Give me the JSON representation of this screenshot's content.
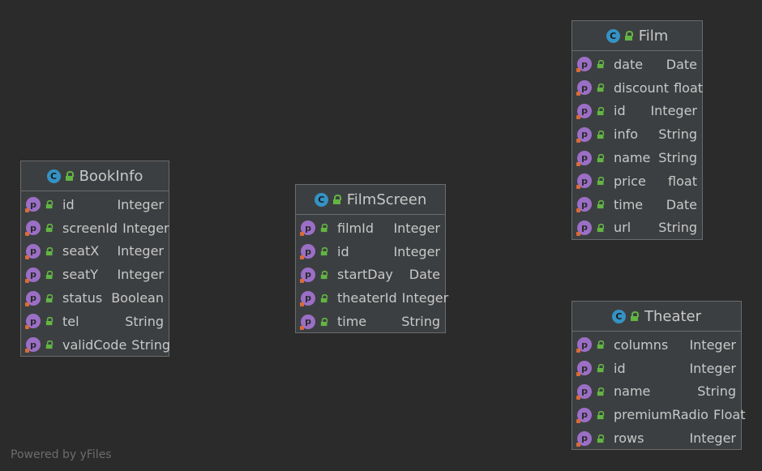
{
  "classes": [
    {
      "name": "BookInfo",
      "icon": "c-class-icon",
      "fields": [
        {
          "name": "id",
          "type": "Integer"
        },
        {
          "name": "screenId",
          "type": "Integer"
        },
        {
          "name": "seatX",
          "type": "Integer"
        },
        {
          "name": "seatY",
          "type": "Integer"
        },
        {
          "name": "status",
          "type": "Boolean"
        },
        {
          "name": "tel",
          "type": "String"
        },
        {
          "name": "validCode",
          "type": "String"
        }
      ]
    },
    {
      "name": "FilmScreen",
      "icon": "c-class-icon",
      "fields": [
        {
          "name": "filmId",
          "type": "Integer"
        },
        {
          "name": "id",
          "type": "Integer"
        },
        {
          "name": "startDay",
          "type": "Date"
        },
        {
          "name": "theaterId",
          "type": "Integer"
        },
        {
          "name": "time",
          "type": "String"
        }
      ]
    },
    {
      "name": "Film",
      "icon": "c-class-icon",
      "fields": [
        {
          "name": "date",
          "type": "Date"
        },
        {
          "name": "discount",
          "type": "float"
        },
        {
          "name": "id",
          "type": "Integer"
        },
        {
          "name": "info",
          "type": "String"
        },
        {
          "name": "name",
          "type": "String"
        },
        {
          "name": "price",
          "type": "float"
        },
        {
          "name": "time",
          "type": "Date"
        },
        {
          "name": "url",
          "type": "String"
        }
      ]
    },
    {
      "name": "Theater",
      "icon": "c-class-icon",
      "fields": [
        {
          "name": "columns",
          "type": "Integer"
        },
        {
          "name": "id",
          "type": "Integer"
        },
        {
          "name": "name",
          "type": "String"
        },
        {
          "name": "premiumRadio",
          "type": "Float"
        },
        {
          "name": "rows",
          "type": "Integer"
        }
      ]
    }
  ],
  "icons": {
    "class": "C",
    "property": "p"
  },
  "footer": "Powered by yFiles"
}
